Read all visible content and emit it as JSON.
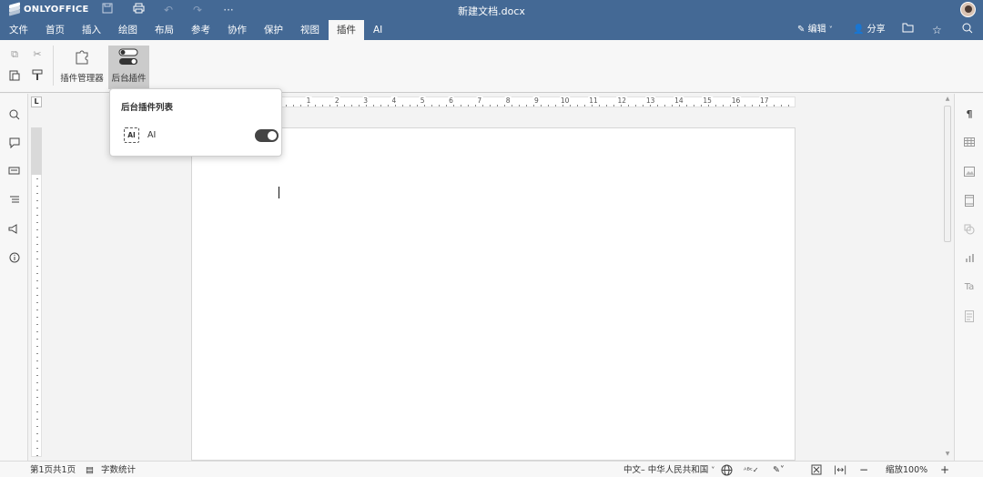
{
  "app": {
    "logo_text": "ONLYOFFICE",
    "doc_title": "新建文档.docx"
  },
  "tabs": [
    {
      "label": "文件"
    },
    {
      "label": "首页"
    },
    {
      "label": "插入"
    },
    {
      "label": "绘图"
    },
    {
      "label": "布局"
    },
    {
      "label": "参考"
    },
    {
      "label": "协作"
    },
    {
      "label": "保护"
    },
    {
      "label": "视图"
    },
    {
      "label": "插件",
      "active": true
    },
    {
      "label": "AI"
    }
  ],
  "header_right": {
    "edit_label": "编辑",
    "share_label": "分享"
  },
  "toolbar": {
    "plugin_manager_label": "插件管理器",
    "background_plugins_label": "后台插件"
  },
  "popover": {
    "title": "后台插件列表",
    "items": [
      {
        "icon_text": "AI",
        "label": "AI",
        "enabled": true
      }
    ]
  },
  "ruler": {
    "numbers": [
      "1",
      "2",
      "3",
      "4",
      "5",
      "6",
      "7",
      "8",
      "9",
      "10",
      "11",
      "12",
      "13",
      "14",
      "15",
      "16",
      "17"
    ]
  },
  "statusbar": {
    "page_info": "第1页共1页",
    "word_count": "字数统计",
    "language": "中文– 中华人民共和国",
    "zoom": "缩放100%"
  },
  "icons": {
    "title_bar": [
      "save-icon",
      "print-icon",
      "undo-icon",
      "redo-icon",
      "more-icon"
    ],
    "left_panel": [
      "search-icon",
      "comments-icon",
      "chat-icon",
      "navigation-icon",
      "feedback-icon",
      "about-icon"
    ],
    "right_panel": [
      "paragraph-icon",
      "table-icon",
      "image-icon",
      "header-footer-icon",
      "shape-icon",
      "chart-icon",
      "text-art-icon",
      "form-icon"
    ]
  },
  "colors": {
    "header_bg": "#446995",
    "toolbar_bg": "#f7f7f7",
    "toggle_on": "#444444"
  }
}
